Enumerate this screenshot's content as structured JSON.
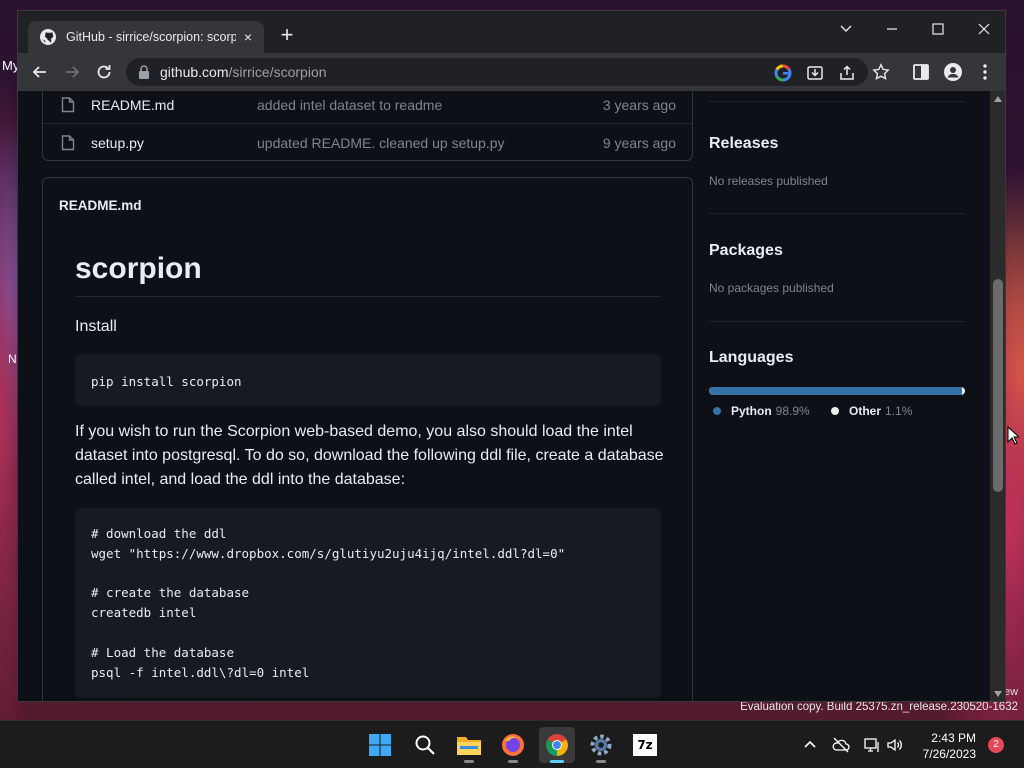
{
  "desktop": {
    "icon_label_top": "My",
    "icon_label_mid": "N",
    "icon_label_right": "ew",
    "evaluation_text": "Evaluation copy. Build 25375.zn_release.230520-1632"
  },
  "browser": {
    "tab": {
      "title": "GitHub - sirrice/scorpion: scorpion",
      "close_label": "×"
    },
    "new_tab_label": "+",
    "address": {
      "host": "github.com",
      "path": "/sirrice/scorpion"
    }
  },
  "files": [
    {
      "name": "README.md",
      "message": "added intel dataset to readme",
      "age": "3 years ago"
    },
    {
      "name": "setup.py",
      "message": "updated README. cleaned up setup.py",
      "age": "9 years ago"
    }
  ],
  "readme": {
    "header": "README.md",
    "title": "scorpion",
    "install_label": "Install",
    "install_code": "pip install scorpion",
    "description": "If you wish to run the Scorpion web-based demo, you also should load the intel dataset into postgresql. To do so, download the following ddl file, create a database called intel, and load the ddl into the database:",
    "code_lines": [
      "# download the ddl",
      "wget \"https://www.dropbox.com/s/glutiyu2uju4ijq/intel.ddl?dl=0\"",
      "",
      "# create the database",
      "createdb intel",
      "",
      "# Load the database",
      "psql -f intel.ddl\\?dl=0 intel"
    ]
  },
  "sidebar": {
    "releases": {
      "title": "Releases",
      "subtitle": "No releases published"
    },
    "packages": {
      "title": "Packages",
      "subtitle": "No packages published"
    },
    "languages": {
      "title": "Languages",
      "items": [
        {
          "name": "Python",
          "percent": "98.9%",
          "fraction": 0.989,
          "color": "#3572a5"
        },
        {
          "name": "Other",
          "percent": "1.1%",
          "fraction": 0.011,
          "color": "#ededed"
        }
      ]
    }
  },
  "taskbar": {
    "apps": [
      "start-icon",
      "search-icon",
      "file-explorer-icon",
      "firefox-icon",
      "chrome-icon",
      "settings-icon",
      "7zip-icon"
    ],
    "sevenzip_label": "7z",
    "time": "2:43 PM",
    "date": "7/26/2023",
    "notification_count": "2"
  }
}
